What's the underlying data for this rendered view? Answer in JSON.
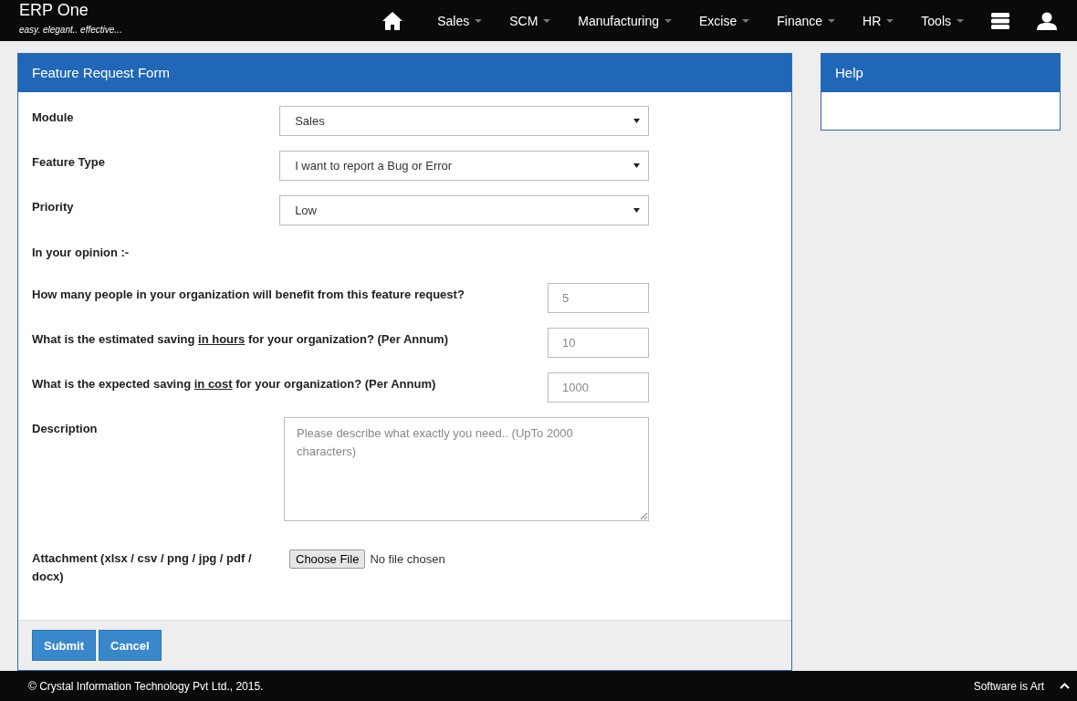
{
  "app": {
    "title": "ERP One",
    "tagline": "easy. elegant.. effective..."
  },
  "nav": {
    "items": [
      {
        "label": "Sales"
      },
      {
        "label": "SCM"
      },
      {
        "label": "Manufacturing"
      },
      {
        "label": "Excise"
      },
      {
        "label": "Finance"
      },
      {
        "label": "HR"
      },
      {
        "label": "Tools"
      }
    ]
  },
  "form": {
    "title": "Feature Request Form",
    "fields": [
      {
        "kind": "select",
        "label": "Module",
        "value": "Sales"
      },
      {
        "kind": "select",
        "label": "Feature Type",
        "value": "I want to report a Bug or Error"
      },
      {
        "kind": "select",
        "label": "Priority",
        "value": "Low"
      },
      {
        "kind": "heading",
        "label": "In your opinion :-"
      },
      {
        "kind": "question",
        "label_parts": [
          {
            "text": "How many people in your organization will benefit from this feature request?",
            "underline": false
          }
        ],
        "placeholder": "5"
      },
      {
        "kind": "question",
        "label_parts": [
          {
            "text": "What is the estimated saving ",
            "underline": false
          },
          {
            "text": "in hours",
            "underline": true
          },
          {
            "text": " for your organization? (Per Annum)",
            "underline": false
          }
        ],
        "placeholder": "10"
      },
      {
        "kind": "question",
        "label_parts": [
          {
            "text": "What is the expected saving ",
            "underline": false
          },
          {
            "text": "in cost",
            "underline": true
          },
          {
            "text": " for your organization? (Per Annum)",
            "underline": false
          }
        ],
        "placeholder": "1000"
      },
      {
        "kind": "textarea",
        "label": "Description",
        "placeholder": "Please describe what exactly you need.. (UpTo 2000 characters)"
      },
      {
        "kind": "file",
        "label": "Attachment (xlsx / csv / png / jpg / pdf / docx)",
        "button": "Choose File",
        "status": "No file chosen"
      }
    ],
    "buttons": [
      "Submit",
      "Cancel"
    ]
  },
  "help": {
    "title": "Help"
  },
  "footer": {
    "copyright": "© Crystal Information Technology Pvt Ltd., 2015.",
    "tagline": "Software is Art"
  }
}
